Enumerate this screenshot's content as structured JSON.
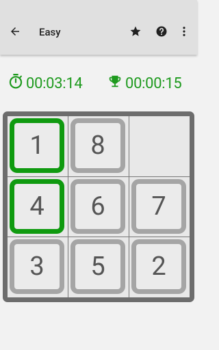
{
  "appbar": {
    "title": "Easy",
    "back_icon": "arrow-back-icon",
    "star_icon": "star-icon",
    "help_icon": "help-icon",
    "more_icon": "more-vert-icon"
  },
  "timers": {
    "elapsed": "00:03:14",
    "best": "00:00:15",
    "elapsed_icon": "stopwatch-icon",
    "best_icon": "trophy-icon",
    "color": "#1e9a1e"
  },
  "board": {
    "tiles": [
      {
        "value": "1",
        "state": "correct"
      },
      {
        "value": "8",
        "state": "misplaced"
      },
      {
        "value": "",
        "state": "empty"
      },
      {
        "value": "4",
        "state": "correct"
      },
      {
        "value": "6",
        "state": "misplaced"
      },
      {
        "value": "7",
        "state": "misplaced"
      },
      {
        "value": "3",
        "state": "misplaced"
      },
      {
        "value": "5",
        "state": "misplaced"
      },
      {
        "value": "2",
        "state": "misplaced"
      }
    ],
    "colors": {
      "correct": "#0f9a0f",
      "misplaced": "#a5a5a5"
    }
  }
}
